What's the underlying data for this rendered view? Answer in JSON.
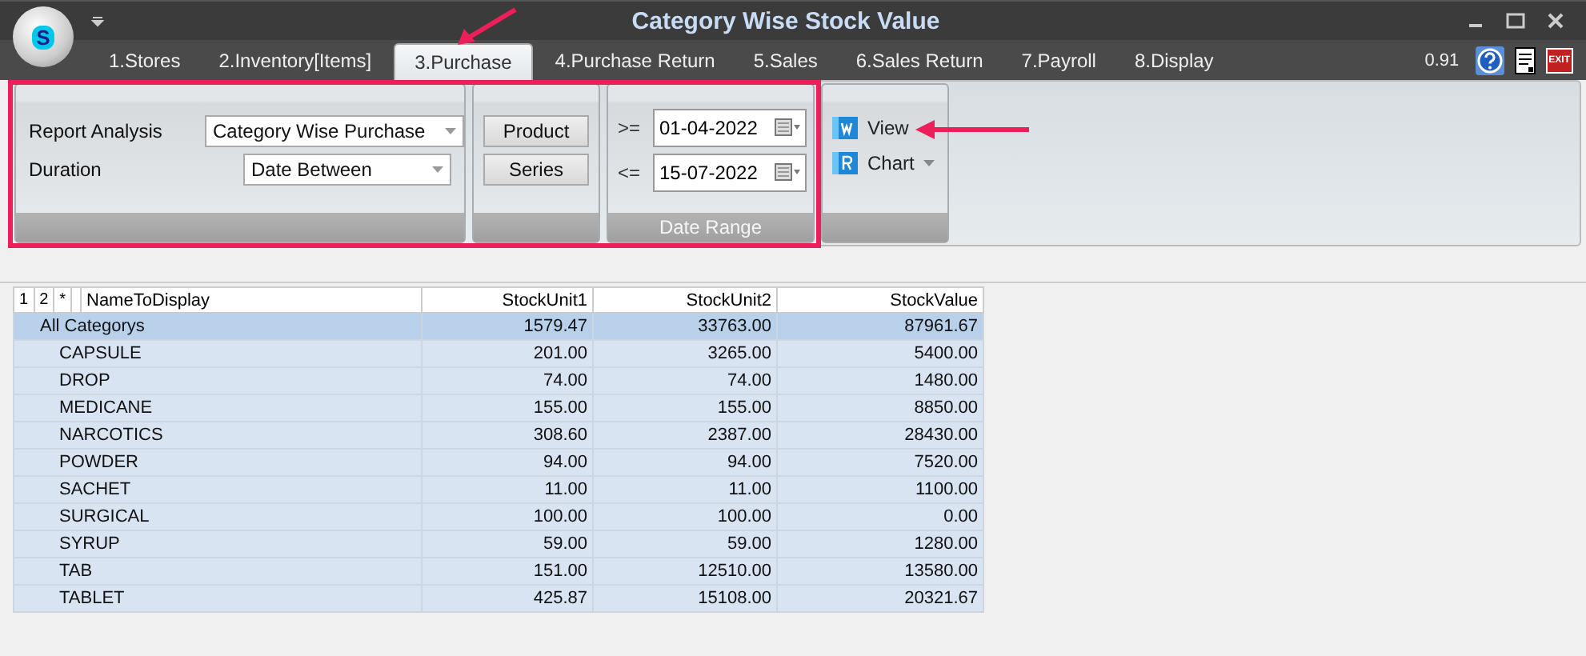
{
  "window": {
    "title": "Category Wise Stock Value",
    "logo_text": "S",
    "version": "0.91",
    "exit_label": "EXIT"
  },
  "tabs": [
    {
      "label": "1.Stores",
      "selected": false
    },
    {
      "label": "2.Inventory[Items]",
      "selected": false
    },
    {
      "label": "3.Purchase",
      "selected": true
    },
    {
      "label": "4.Purchase Return",
      "selected": false
    },
    {
      "label": "5.Sales",
      "selected": false
    },
    {
      "label": "6.Sales Return",
      "selected": false
    },
    {
      "label": "7.Payroll",
      "selected": false
    },
    {
      "label": "8.Display",
      "selected": false
    }
  ],
  "ribbon": {
    "report_analysis": {
      "label": "Report Analysis",
      "value": "Category Wise Purchase"
    },
    "duration": {
      "label": "Duration",
      "value": "Date Between"
    },
    "buttons": [
      "Product",
      "Series"
    ],
    "date_range": {
      "title": "Date Range",
      "from_op": ">=",
      "from": "01-04-2022",
      "to_op": "<=",
      "to": "15-07-2022"
    },
    "actions": [
      {
        "label": "View",
        "kind": "view",
        "has_menu": false
      },
      {
        "label": "Chart",
        "kind": "chart",
        "has_menu": true
      }
    ]
  },
  "table": {
    "level_buttons": [
      "1",
      "2",
      "*"
    ],
    "columns": [
      "NameToDisplay",
      "StockUnit1",
      "StockUnit2",
      "StockValue"
    ],
    "rows": [
      {
        "cells": [
          "All Categorys",
          "1579.47",
          "33763.00",
          "87961.67"
        ],
        "selected": true,
        "children": [
          {
            "cells": [
              "CAPSULE",
              "201.00",
              "3265.00",
              "5400.00"
            ],
            "selected": false
          },
          {
            "cells": [
              "DROP",
              "74.00",
              "74.00",
              "1480.00"
            ],
            "selected": false
          },
          {
            "cells": [
              "MEDICANE",
              "155.00",
              "155.00",
              "8850.00"
            ],
            "selected": false
          },
          {
            "cells": [
              "NARCOTICS",
              "308.60",
              "2387.00",
              "28430.00"
            ],
            "selected": false
          },
          {
            "cells": [
              "POWDER",
              "94.00",
              "94.00",
              "7520.00"
            ],
            "selected": false
          },
          {
            "cells": [
              "SACHET",
              "11.00",
              "11.00",
              "1100.00"
            ],
            "selected": false
          },
          {
            "cells": [
              "SURGICAL",
              "100.00",
              "100.00",
              "0.00"
            ],
            "selected": false
          },
          {
            "cells": [
              "SYRUP",
              "59.00",
              "59.00",
              "1280.00"
            ],
            "selected": false
          },
          {
            "cells": [
              "TAB",
              "151.00",
              "12510.00",
              "13580.00"
            ],
            "selected": false
          },
          {
            "cells": [
              "TABLET",
              "425.87",
              "15108.00",
              "20321.67"
            ],
            "selected": false
          }
        ]
      }
    ]
  }
}
